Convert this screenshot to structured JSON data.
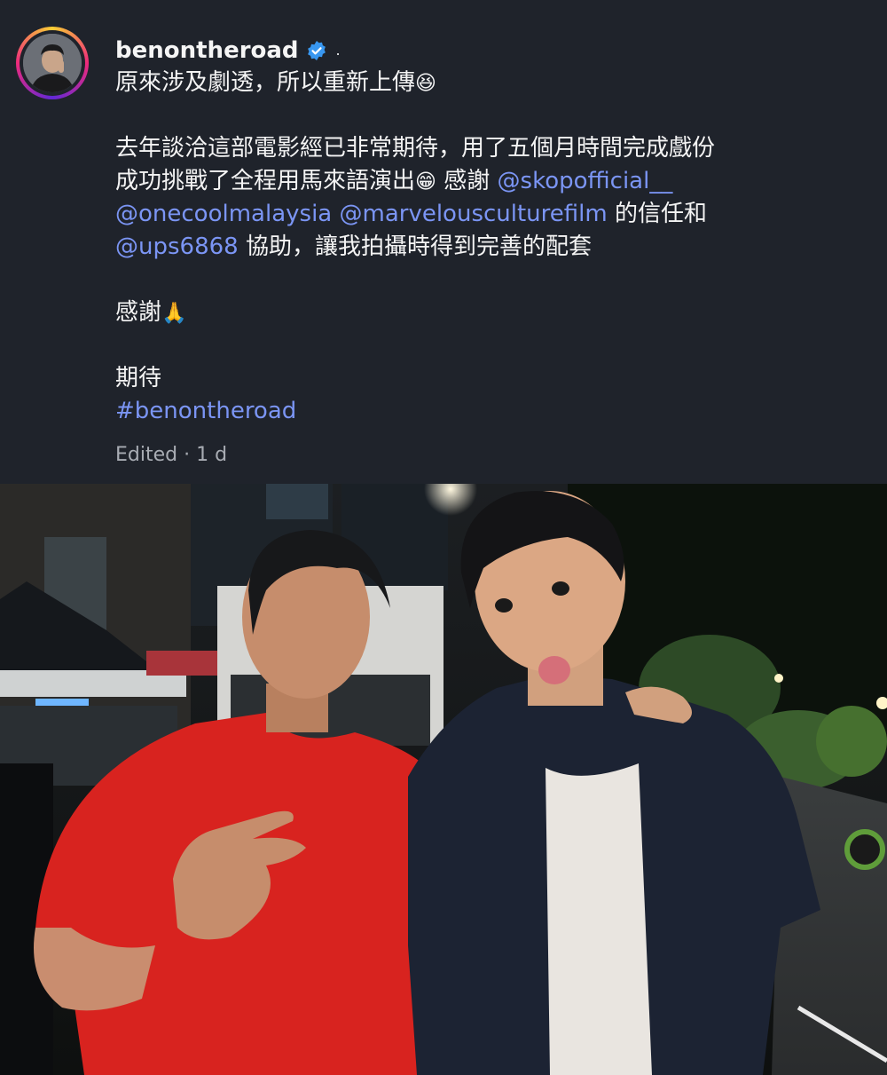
{
  "post": {
    "username": "benontheroad",
    "separator": ".",
    "line1_text": "原來涉及劇透，所以重新上傳",
    "line1_emoji": "😆",
    "line2": "去年談洽這部電影經已非常期待，用了五個月時間完成戲份",
    "line3_text": "成功挑戰了全程用馬來語演出",
    "line3_emoji": "😁",
    "line3_thanks": " 感謝 ",
    "mention1": "@skopofficial__",
    "mention2": "@onecoolmalaysia",
    "mention3": "@marvelousculturefilm",
    "line4_suffix": " 的信任和",
    "mention4": "@ups6868",
    "line5_suffix": " 協助，讓我拍攝時得到完善的配套",
    "thanks_text": "感謝",
    "thanks_emoji": "🙏",
    "looking_forward": "期待",
    "hashtag": "#benontheroad",
    "meta": "Edited · 1 d"
  },
  "colors": {
    "background": "#1f232b",
    "link": "#7b95f4",
    "verified_badge": "#3897f0"
  },
  "icons": {
    "verified": "verified-badge-icon"
  }
}
